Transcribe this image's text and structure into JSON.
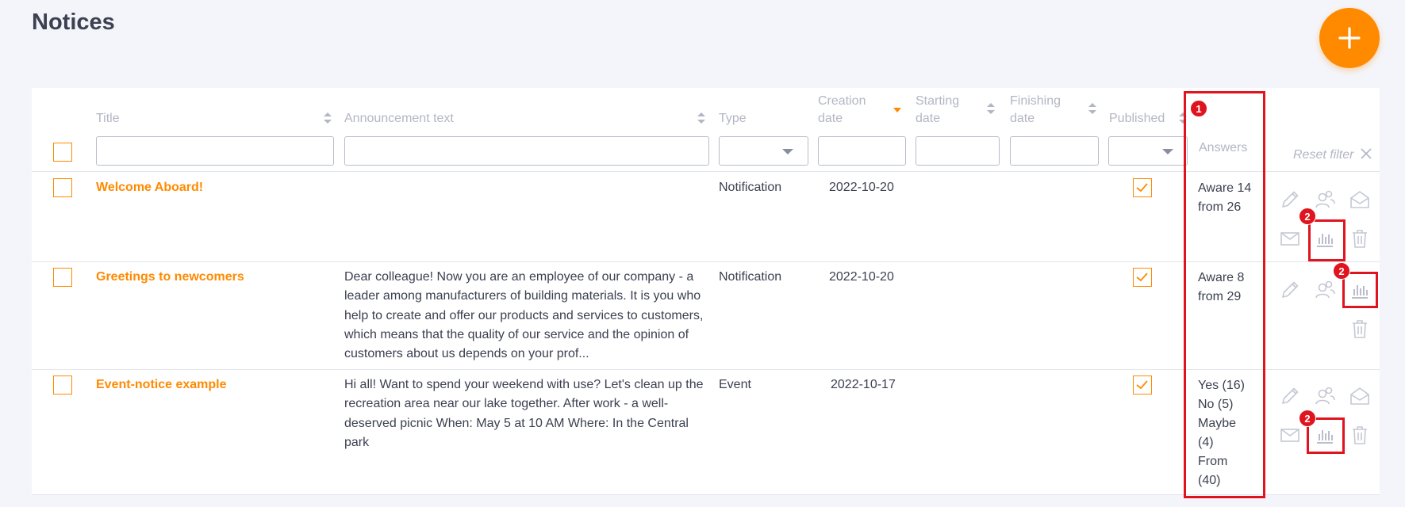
{
  "page": {
    "title": "Notices",
    "add_label": "+"
  },
  "columns": {
    "title": "Title",
    "announcement": "Announcement text",
    "type": "Type",
    "creation_1": "Creation",
    "creation_2": "date",
    "starting_1": "Starting",
    "starting_2": "date",
    "finishing_1": "Finishing",
    "finishing_2": "date",
    "published": "Published",
    "answers": "Answers"
  },
  "reset_filter": "Reset filter",
  "rows": [
    {
      "title": "Welcome Aboard!",
      "text": "",
      "type": "Notification",
      "created": "2022-10-20",
      "answers": [
        "Aware 14",
        "from 26"
      ]
    },
    {
      "title": "Greetings to newcomers",
      "text": "Dear colleague! Now you are an employee of our company - a leader among manufacturers of building materials. It is you who help to create and offer our products and services to customers, which means that the quality of our service and the opinion of customers about us depends on your prof...",
      "type": "Notification",
      "created": "2022-10-20",
      "answers": [
        "Aware 8",
        "from 29"
      ]
    },
    {
      "title": "Event-notice example",
      "text": "Hi all!  Want to spend your weekend with use? Let's clean up the recreation area near our lake together. After work - a well-deserved picnic  When: May 5 at 10 AM  Where: In the Central park",
      "type": "Event",
      "created": "2022-10-17",
      "answers": [
        "Yes (16)",
        "No (5)",
        "Maybe",
        "(4)",
        "From",
        "(40)"
      ]
    }
  ],
  "annotations": {
    "badge_1": "1",
    "badge_2a": "2",
    "badge_2b": "2",
    "badge_2c": "2"
  },
  "colors": {
    "accent": "#ff8a00",
    "text": "#3c4050",
    "muted": "#b3b6c4",
    "highlight": "#e0141e",
    "background": "#f4f5fa"
  },
  "icons": [
    "plus-icon",
    "sort-icon",
    "sort-desc-icon",
    "chevron-down-icon",
    "checkmark-icon",
    "pencil-icon",
    "users-icon",
    "envelope-open-icon",
    "envelope-icon",
    "bar-chart-icon",
    "trash-icon",
    "close-icon"
  ]
}
